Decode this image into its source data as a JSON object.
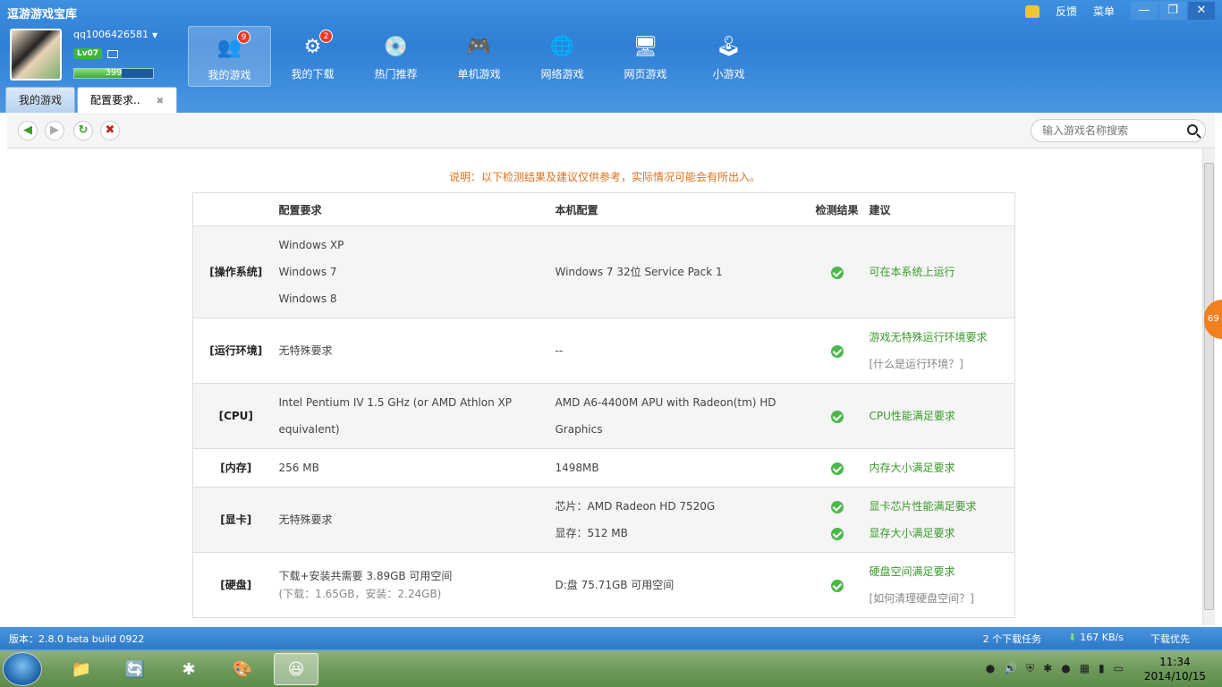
{
  "app": {
    "title": "逗游游戏宝库",
    "top_links": [
      "反馈",
      "菜单"
    ],
    "window_controls": {
      "minimize": "—",
      "maximize": "❐",
      "close": "✕"
    }
  },
  "user": {
    "name": "qq1006426581",
    "level": "Lv07",
    "exp": "399",
    "exp_fraction": 0.6
  },
  "nav": [
    {
      "label": "我的游戏",
      "badge": "9",
      "icon": "people-icon",
      "glyph": "👥"
    },
    {
      "label": "我的下载",
      "badge": "2",
      "icon": "download-gear-icon",
      "glyph": "⚙"
    },
    {
      "label": "热门推荐",
      "badge": "",
      "icon": "recommend-disc-icon",
      "glyph": "💿"
    },
    {
      "label": "单机游戏",
      "badge": "",
      "icon": "gamepad-icon",
      "glyph": "🎮"
    },
    {
      "label": "网络游戏",
      "badge": "",
      "icon": "globe-icon",
      "glyph": "🌐"
    },
    {
      "label": "网页游戏",
      "badge": "",
      "icon": "web-game-icon",
      "glyph": "🖥"
    },
    {
      "label": "小游戏",
      "badge": "",
      "icon": "joystick-icon",
      "glyph": "🕹"
    }
  ],
  "tabs": [
    {
      "label": "我的游戏"
    },
    {
      "label": "配置要求.."
    }
  ],
  "search": {
    "placeholder": "输入游戏名称搜索"
  },
  "notice": "说明：以下检测结果及建议仅供参考，实际情况可能会有所出入。",
  "table": {
    "headers": {
      "req": "配置要求",
      "mine": "本机配置",
      "result": "检测结果",
      "advice": "建议"
    },
    "rows": [
      {
        "cat": "[操作系统]",
        "req": [
          "Windows XP",
          "Windows 7",
          "Windows 8"
        ],
        "mine": [
          "Windows 7 32位 Service Pack 1"
        ],
        "checks": 1,
        "advice": [
          "可在本系统上运行"
        ]
      },
      {
        "cat": "[运行环境]",
        "req": [
          "无特殊要求"
        ],
        "mine": [
          "--"
        ],
        "checks": 1,
        "advice": [
          "游戏无特殊运行环境要求",
          "[什么是运行环境？]"
        ]
      },
      {
        "cat": "[CPU]",
        "req": [
          "Intel Pentium IV 1.5 GHz (or AMD Athlon XP",
          "equivalent)"
        ],
        "mine": [
          "AMD A6-4400M APU with Radeon(tm) HD",
          "Graphics"
        ],
        "checks": 1,
        "advice": [
          "CPU性能满足要求"
        ]
      },
      {
        "cat": "[内存]",
        "req": [
          "256 MB"
        ],
        "mine": [
          "1498MB"
        ],
        "checks": 1,
        "advice": [
          "内存大小满足要求"
        ]
      },
      {
        "cat": "[显卡]",
        "req": [
          "无特殊要求"
        ],
        "mine": [
          "芯片：AMD Radeon HD 7520G",
          "显存：512 MB"
        ],
        "checks": 2,
        "advice": [
          "显卡芯片性能满足要求",
          "显存大小满足要求"
        ]
      },
      {
        "cat": "[硬盘]",
        "req": [
          "下载+安装共需要 3.89GB 可用空间",
          "(下载：1.65GB，安装：2.24GB)"
        ],
        "mine": [
          "D:盘 75.71GB 可用空间"
        ],
        "checks": 1,
        "advice": [
          "硬盘空间满足要求",
          "[如何清理硬盘空间？]"
        ]
      }
    ]
  },
  "float_ball": "69",
  "status": {
    "version": "版本：2.8.0 beta build 0922",
    "downloads": "2 个下载任务",
    "speed": "167 KB/s",
    "priority": "下载优先"
  },
  "taskbar": {
    "time": "11:34",
    "date": "2014/10/15"
  }
}
